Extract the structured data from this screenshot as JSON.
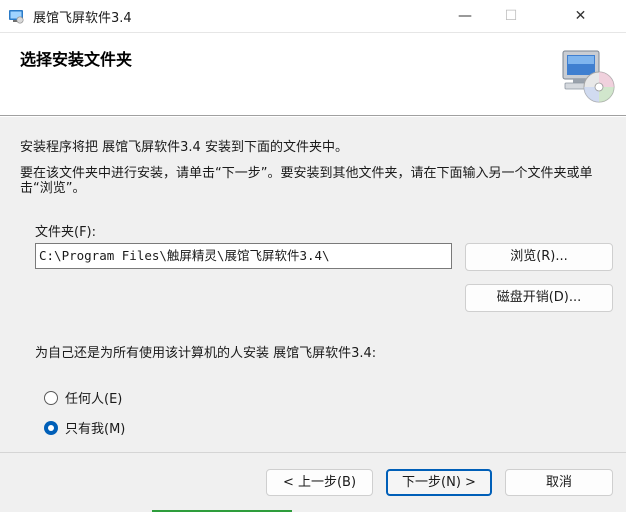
{
  "window": {
    "title": "展馆飞屏软件3.4",
    "icon": "installer-app-icon",
    "controls": {
      "minimize": "—",
      "maximize": "☐",
      "close": "✕"
    }
  },
  "header": {
    "title": "选择安装文件夹",
    "graphic": "computer-with-cd-icon"
  },
  "content": {
    "info_line1": "安装程序将把 展馆飞屏软件3.4 安装到下面的文件夹中。",
    "info_line2": "要在该文件夹中进行安装，请单击“下一步”。要安装到其他文件夹，请在下面输入另一个文件夹或单击“浏览”。",
    "folder_label": "文件夹(F):",
    "folder_value": "C:\\Program Files\\触屏精灵\\展馆飞屏软件3.4\\",
    "browse_button": "浏览(R)...",
    "disk_cost_button": "磁盘开销(D)...",
    "install_scope_label": "为自己还是为所有使用该计算机的人安装 展馆飞屏软件3.4:",
    "options": [
      {
        "label": "任何人(E)",
        "checked": false
      },
      {
        "label": "只有我(M)",
        "checked": true
      }
    ]
  },
  "footer": {
    "back_button": "< 上一步(B)",
    "next_button": "下一步(N) >",
    "cancel_button": "取消"
  },
  "colors": {
    "accent": "#005fb8",
    "background": "#f0f0f0"
  }
}
